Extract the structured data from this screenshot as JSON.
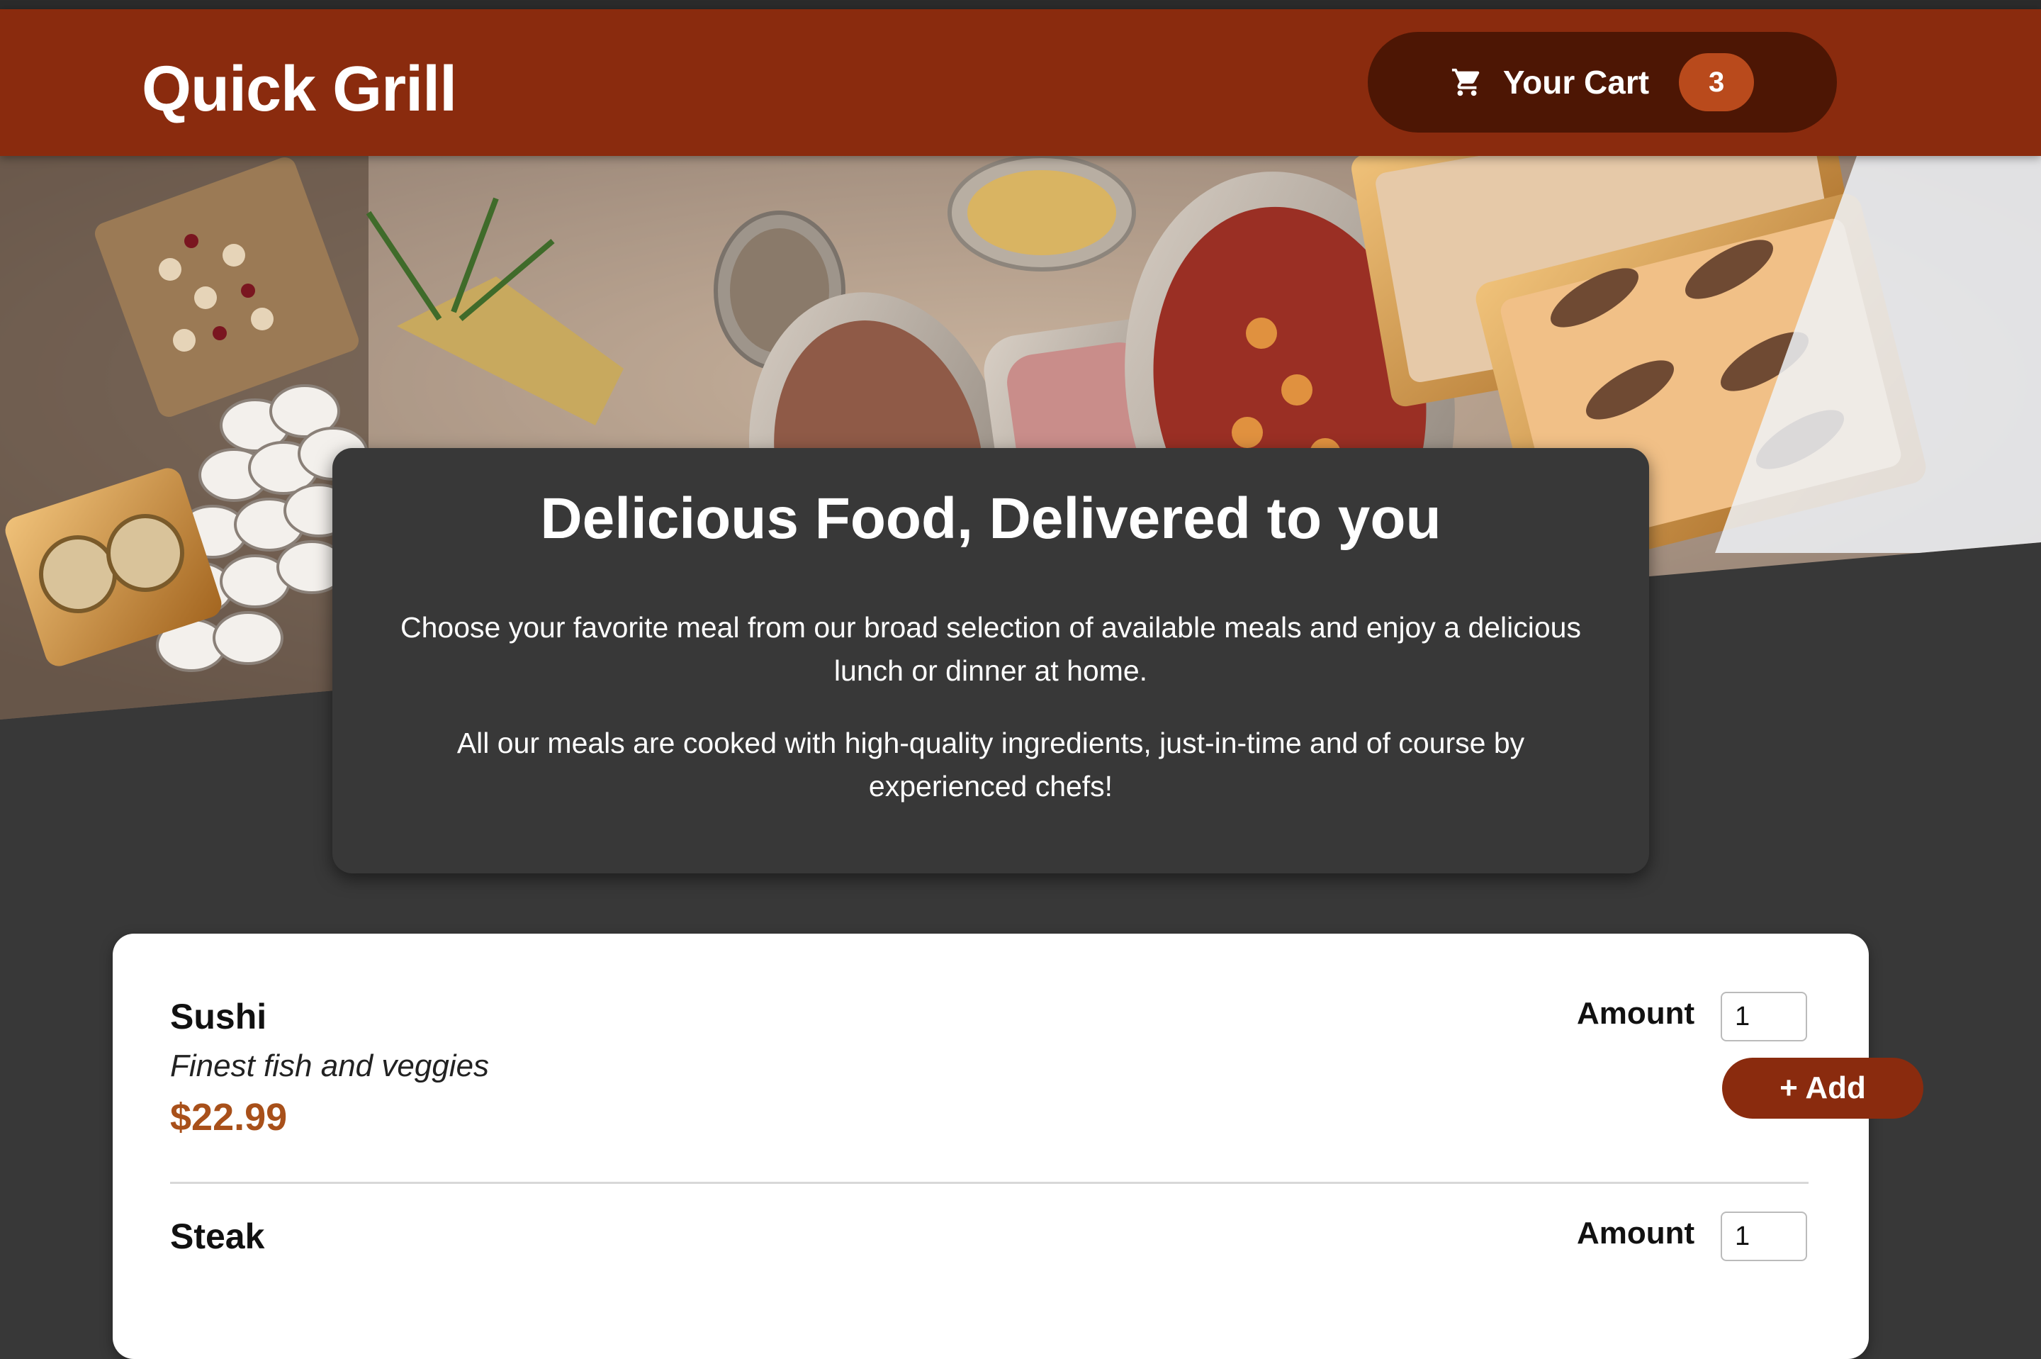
{
  "header": {
    "brand": "Quick Grill",
    "cart": {
      "label": "Your Cart",
      "count": "3",
      "icon": "cart-icon"
    }
  },
  "summary": {
    "title": "Delicious Food, Delivered to you",
    "paragraph1": "Choose your favorite meal from our broad selection of available meals and enjoy a delicious lunch or dinner at home.",
    "paragraph2": "All our meals are cooked with high-quality ingredients, just-in-time and of course by experienced chefs!"
  },
  "meals": [
    {
      "name": "Sushi",
      "description": "Finest fish and veggies",
      "price": "$22.99",
      "amount_label": "Amount",
      "amount_value": "1",
      "add_label": "+ Add"
    },
    {
      "name": "Steak",
      "amount_label": "Amount",
      "amount_value": "1"
    }
  ],
  "colors": {
    "header": "#8a2b0e",
    "cart_button": "#4d1604",
    "badge": "#b94a1c",
    "price": "#a8501a",
    "background": "#383838"
  }
}
